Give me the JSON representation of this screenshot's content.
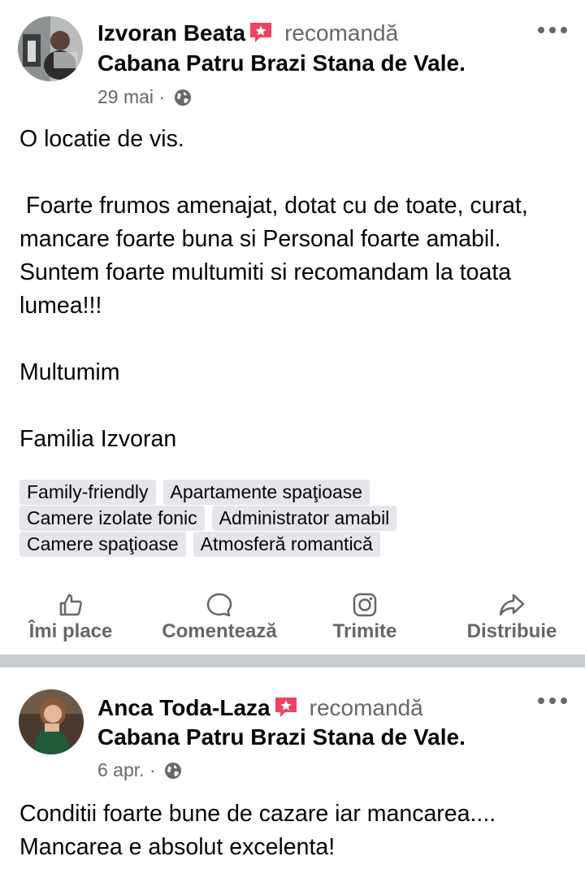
{
  "posts": [
    {
      "author": "Izvoran Beata",
      "action_word": "recomandă",
      "page": "Cabana Patru Brazi Stana de Vale",
      "date": "29 mai",
      "separator": "·",
      "paragraphs": [
        "O locatie de vis.",
        "",
        " Foarte frumos amenajat, dotat cu de toate, curat, mancare foarte buna si Personal foarte amabil. Suntem foarte multumiti si recomandam la toata lumea!!!",
        "",
        "Multumim",
        "",
        "Familia Izvoran"
      ],
      "tags": [
        [
          "Family-friendly",
          "Apartamente spaţioase"
        ],
        [
          "Camere izolate fonic",
          "Administrator amabil"
        ],
        [
          "Camere spaţioase",
          "Atmosferă romantică"
        ]
      ]
    },
    {
      "author": "Anca Toda-Laza",
      "action_word": "recomandă",
      "page": "Cabana Patru Brazi Stana de Vale",
      "date": "6 apr.",
      "separator": "·",
      "paragraphs": [
        "Conditii foarte bune de cazare iar mancarea.... Mancarea e absolut excelenta!"
      ]
    }
  ],
  "actions": {
    "like": "Îmi place",
    "comment": "Comentează",
    "send": "Trimite",
    "share": "Distribuie"
  },
  "colors": {
    "text": "#050505",
    "secondary": "#65676b",
    "badge": "#f3425f",
    "tag_bg": "#e4e6eb",
    "divider": "#c9ccd1"
  },
  "icons": {
    "recommend": "recommend-badge-icon",
    "audience": "globe-icon",
    "more": "more-options-icon",
    "like": "thumbs-up-icon",
    "comment": "comment-bubble-icon",
    "send": "instagram-icon",
    "share": "share-arrow-icon"
  }
}
